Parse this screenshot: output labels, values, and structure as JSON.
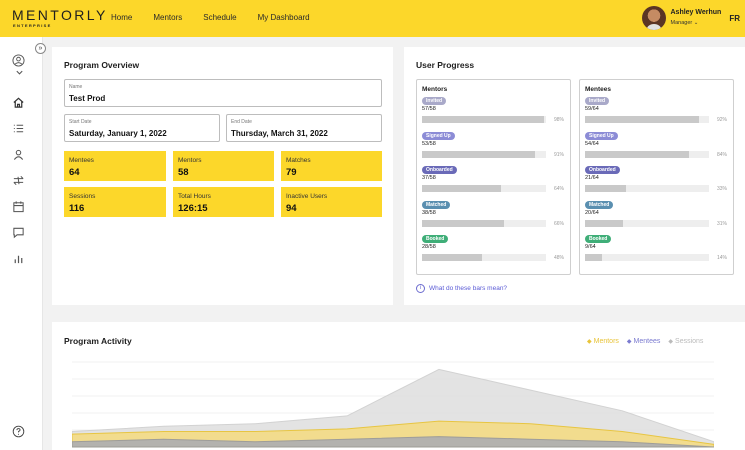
{
  "brand": {
    "name": "MENTORLY",
    "tagline": "ENTERPRISE"
  },
  "nav": [
    "Home",
    "Mentors",
    "Schedule",
    "My Dashboard"
  ],
  "user": {
    "name": "Ashley Werhun",
    "role": "Manager ⌄",
    "language": "FR"
  },
  "colors": {
    "accent": "#fcd72a",
    "mentors": "#e8c43a",
    "mentees": "#7b7bd0",
    "sessions": "#bbbbbb"
  },
  "sidebar": {
    "collapse_icon": "double-chevron-right-icon",
    "icons": [
      "user-circle-icon",
      "chevron-down-icon",
      "home-icon",
      "list-icon",
      "person-icon",
      "swap-icon",
      "calendar-icon",
      "chat-icon",
      "bar-chart-icon",
      "help-circle-icon"
    ]
  },
  "overview": {
    "title": "Program Overview",
    "name_label": "Name",
    "name_value": "Test Prod",
    "start_label": "Start Date",
    "start_value": "Saturday, January 1, 2022",
    "end_label": "End Date",
    "end_value": "Thursday, March 31, 2022",
    "stats": [
      {
        "label": "Mentees",
        "value": "64"
      },
      {
        "label": "Mentors",
        "value": "58"
      },
      {
        "label": "Matches",
        "value": "79"
      },
      {
        "label": "Sessions",
        "value": "116"
      },
      {
        "label": "Total Hours",
        "value": "126:15"
      },
      {
        "label": "Inactive Users",
        "value": "94"
      }
    ]
  },
  "progress": {
    "title": "User Progress",
    "help_text": "What do these bars mean?",
    "mentors": {
      "title": "Mentors",
      "rows": [
        {
          "badge": "Invited",
          "ratio": "57/58",
          "pct": "98%",
          "fill": 0.98,
          "color": "#a9a9c9"
        },
        {
          "badge": "Signed Up",
          "ratio": "53/58",
          "pct": "91%",
          "fill": 0.91,
          "color": "#8c8cd6"
        },
        {
          "badge": "Onboarded",
          "ratio": "37/58",
          "pct": "64%",
          "fill": 0.64,
          "color": "#6a6ab8"
        },
        {
          "badge": "Matched",
          "ratio": "38/58",
          "pct": "66%",
          "fill": 0.66,
          "color": "#5a8fb0"
        },
        {
          "badge": "Booked",
          "ratio": "28/58",
          "pct": "48%",
          "fill": 0.48,
          "color": "#3fae78"
        }
      ]
    },
    "mentees": {
      "title": "Mentees",
      "rows": [
        {
          "badge": "Invited",
          "ratio": "59/64",
          "pct": "92%",
          "fill": 0.92,
          "color": "#a9a9c9"
        },
        {
          "badge": "Signed Up",
          "ratio": "54/64",
          "pct": "84%",
          "fill": 0.84,
          "color": "#8c8cd6"
        },
        {
          "badge": "Onboarded",
          "ratio": "21/64",
          "pct": "33%",
          "fill": 0.33,
          "color": "#6a6ab8"
        },
        {
          "badge": "Matched",
          "ratio": "20/64",
          "pct": "31%",
          "fill": 0.31,
          "color": "#5a8fb0"
        },
        {
          "badge": "Booked",
          "ratio": "9/64",
          "pct": "14%",
          "fill": 0.14,
          "color": "#3fae78"
        }
      ]
    }
  },
  "activity": {
    "title": "Program Activity",
    "legend": [
      "Mentors",
      "Mentees",
      "Sessions"
    ]
  },
  "chart_data": {
    "type": "area",
    "title": "Program Activity",
    "x": [
      0,
      1,
      2,
      3,
      4,
      5,
      6,
      7
    ],
    "series": [
      {
        "name": "Sessions",
        "values": [
          6,
          8,
          9,
          12,
          30,
          22,
          14,
          2
        ]
      },
      {
        "name": "Mentors",
        "values": [
          5,
          6,
          6,
          7,
          10,
          9,
          6,
          1
        ]
      },
      {
        "name": "Mentees",
        "values": [
          2,
          3,
          2,
          3,
          4,
          3,
          2,
          0
        ]
      }
    ],
    "ylim": [
      0,
      34
    ],
    "grid": true,
    "legend_position": "top-right"
  }
}
